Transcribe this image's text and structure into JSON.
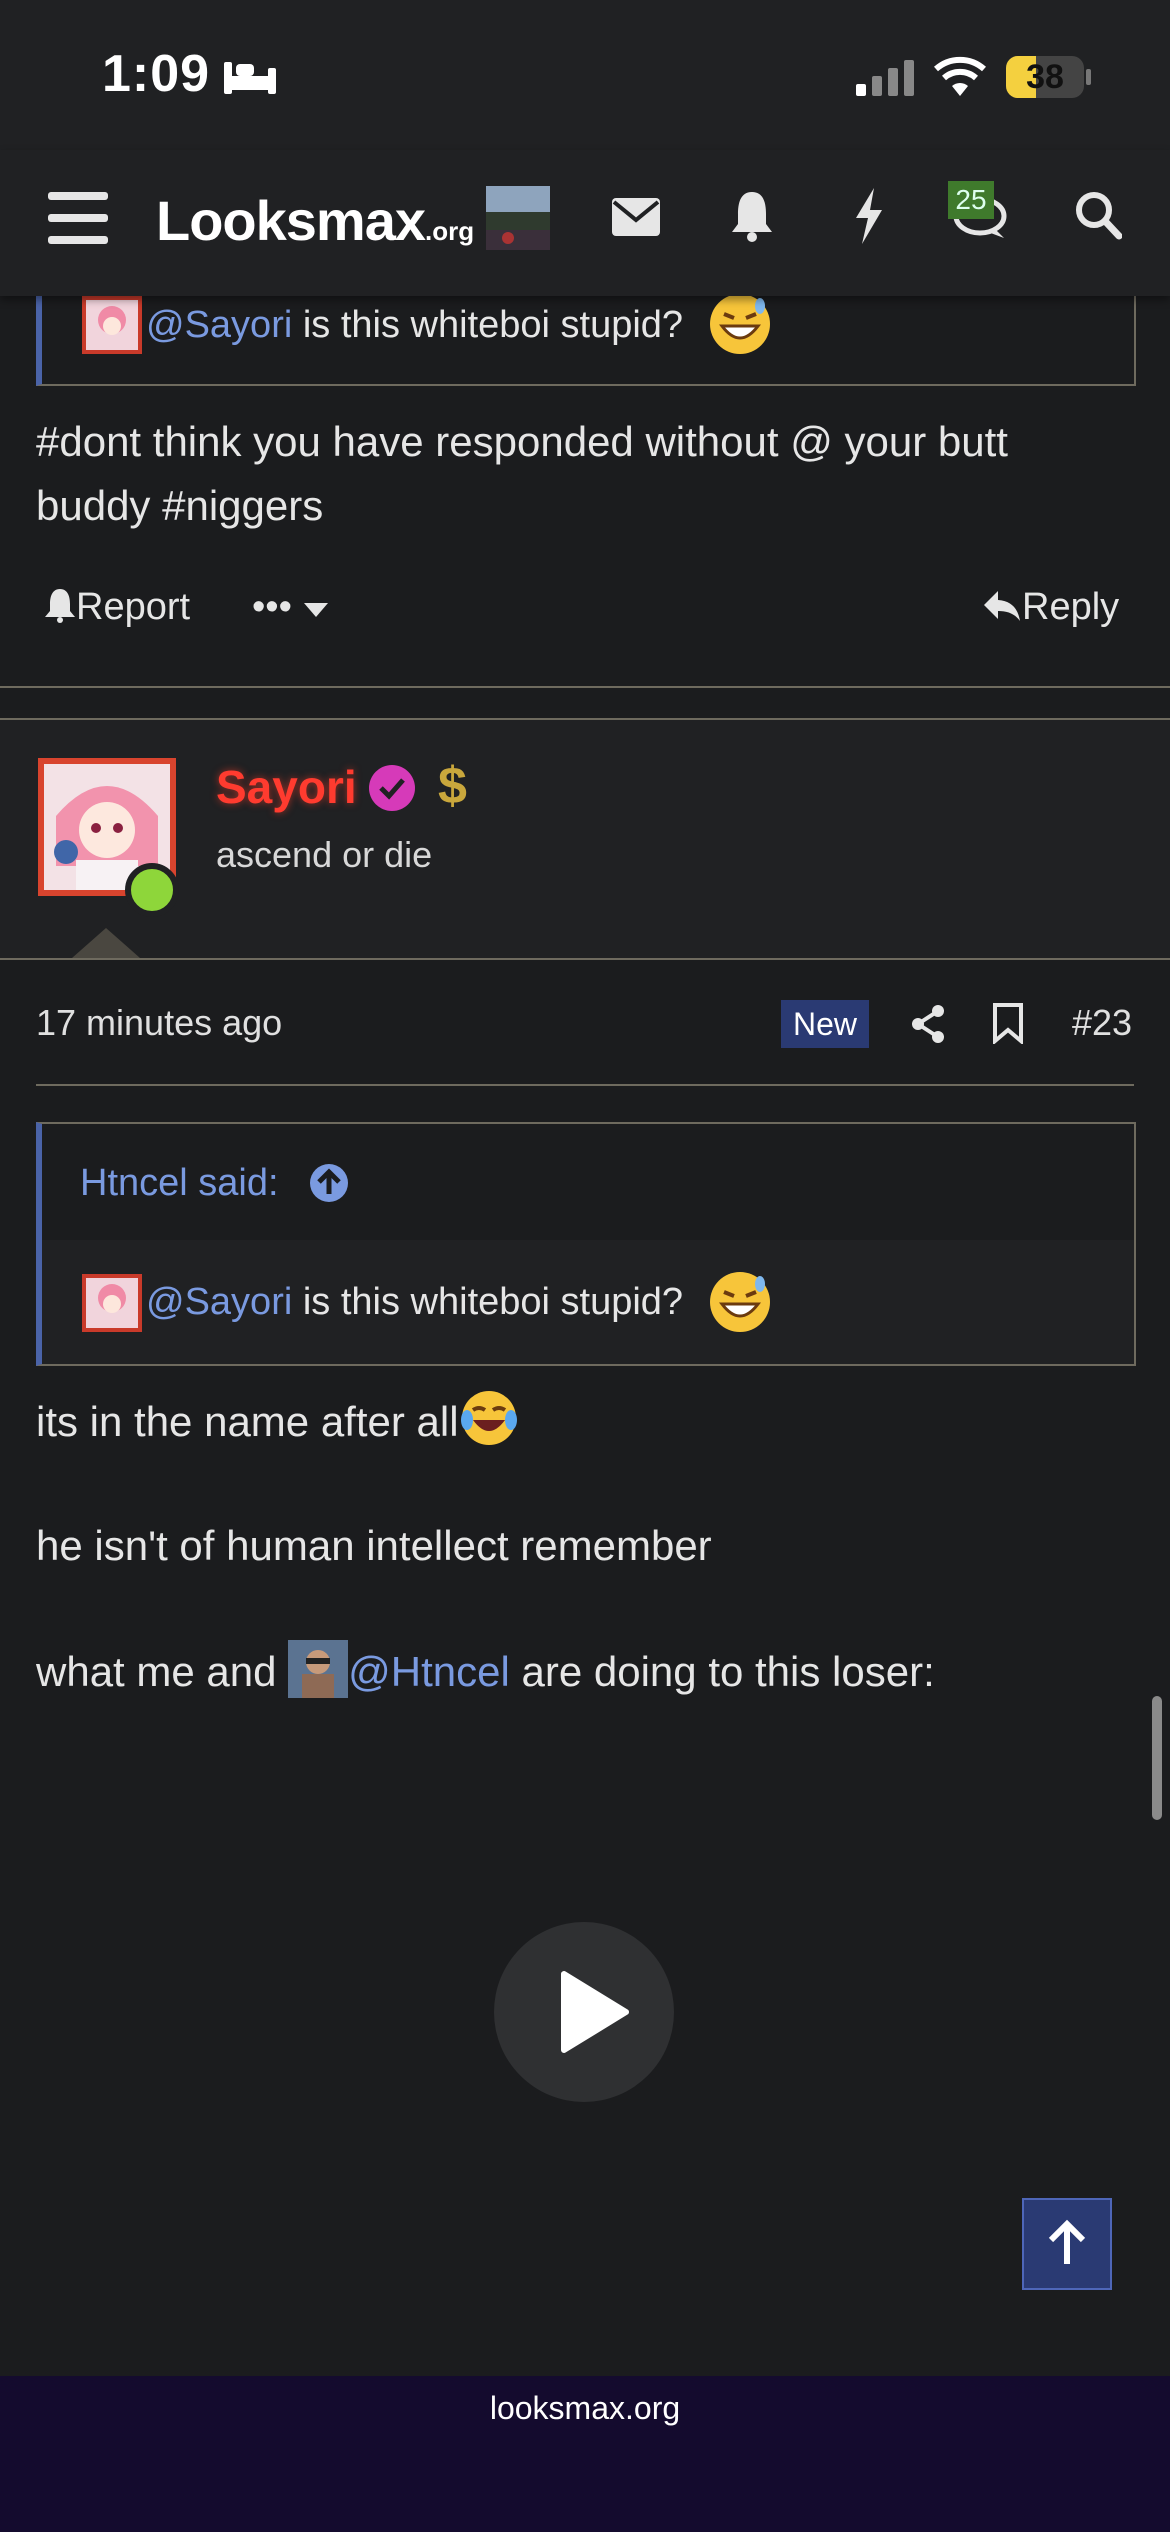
{
  "status": {
    "time": "1:09",
    "battery": "38",
    "battery_level": 0.38
  },
  "header": {
    "logo_main": "Looksmax",
    "logo_suffix": ".org",
    "icons": [
      "menu-icon",
      "avatar",
      "envelope-icon",
      "bell-icon",
      "bolt-icon",
      "chat-icon",
      "search-icon"
    ],
    "chat_badge": "25"
  },
  "prev_post": {
    "quote_mention": "@Sayori",
    "quote_text": " is this whiteboi stupid?",
    "body_line1": "#dont think you have responded without @ your butt",
    "body_line2": "buddy #niggers",
    "report_label": "Report",
    "more_label": "•••",
    "reply_label": "Reply"
  },
  "post": {
    "username": "Sayori",
    "user_title": "ascend or die",
    "time": "17 minutes ago",
    "new_badge": "New",
    "post_number": "#23",
    "quote_author": "Htncel said:",
    "quote_mention": "@Sayori",
    "quote_text": " is this whiteboi stupid?",
    "line1": "its in the name after all",
    "line2": "he isn't of human intellect remember",
    "line3_pre": "what me and ",
    "line3_mention": "@Htncel",
    "line3_post": " are doing to this loser:"
  },
  "footer": {
    "text": "looksmax.org"
  },
  "colors": {
    "accent": "#4a63a8",
    "mention": "#7a9ae0",
    "username": "#ff3b2f",
    "footer": "#140b2e"
  }
}
